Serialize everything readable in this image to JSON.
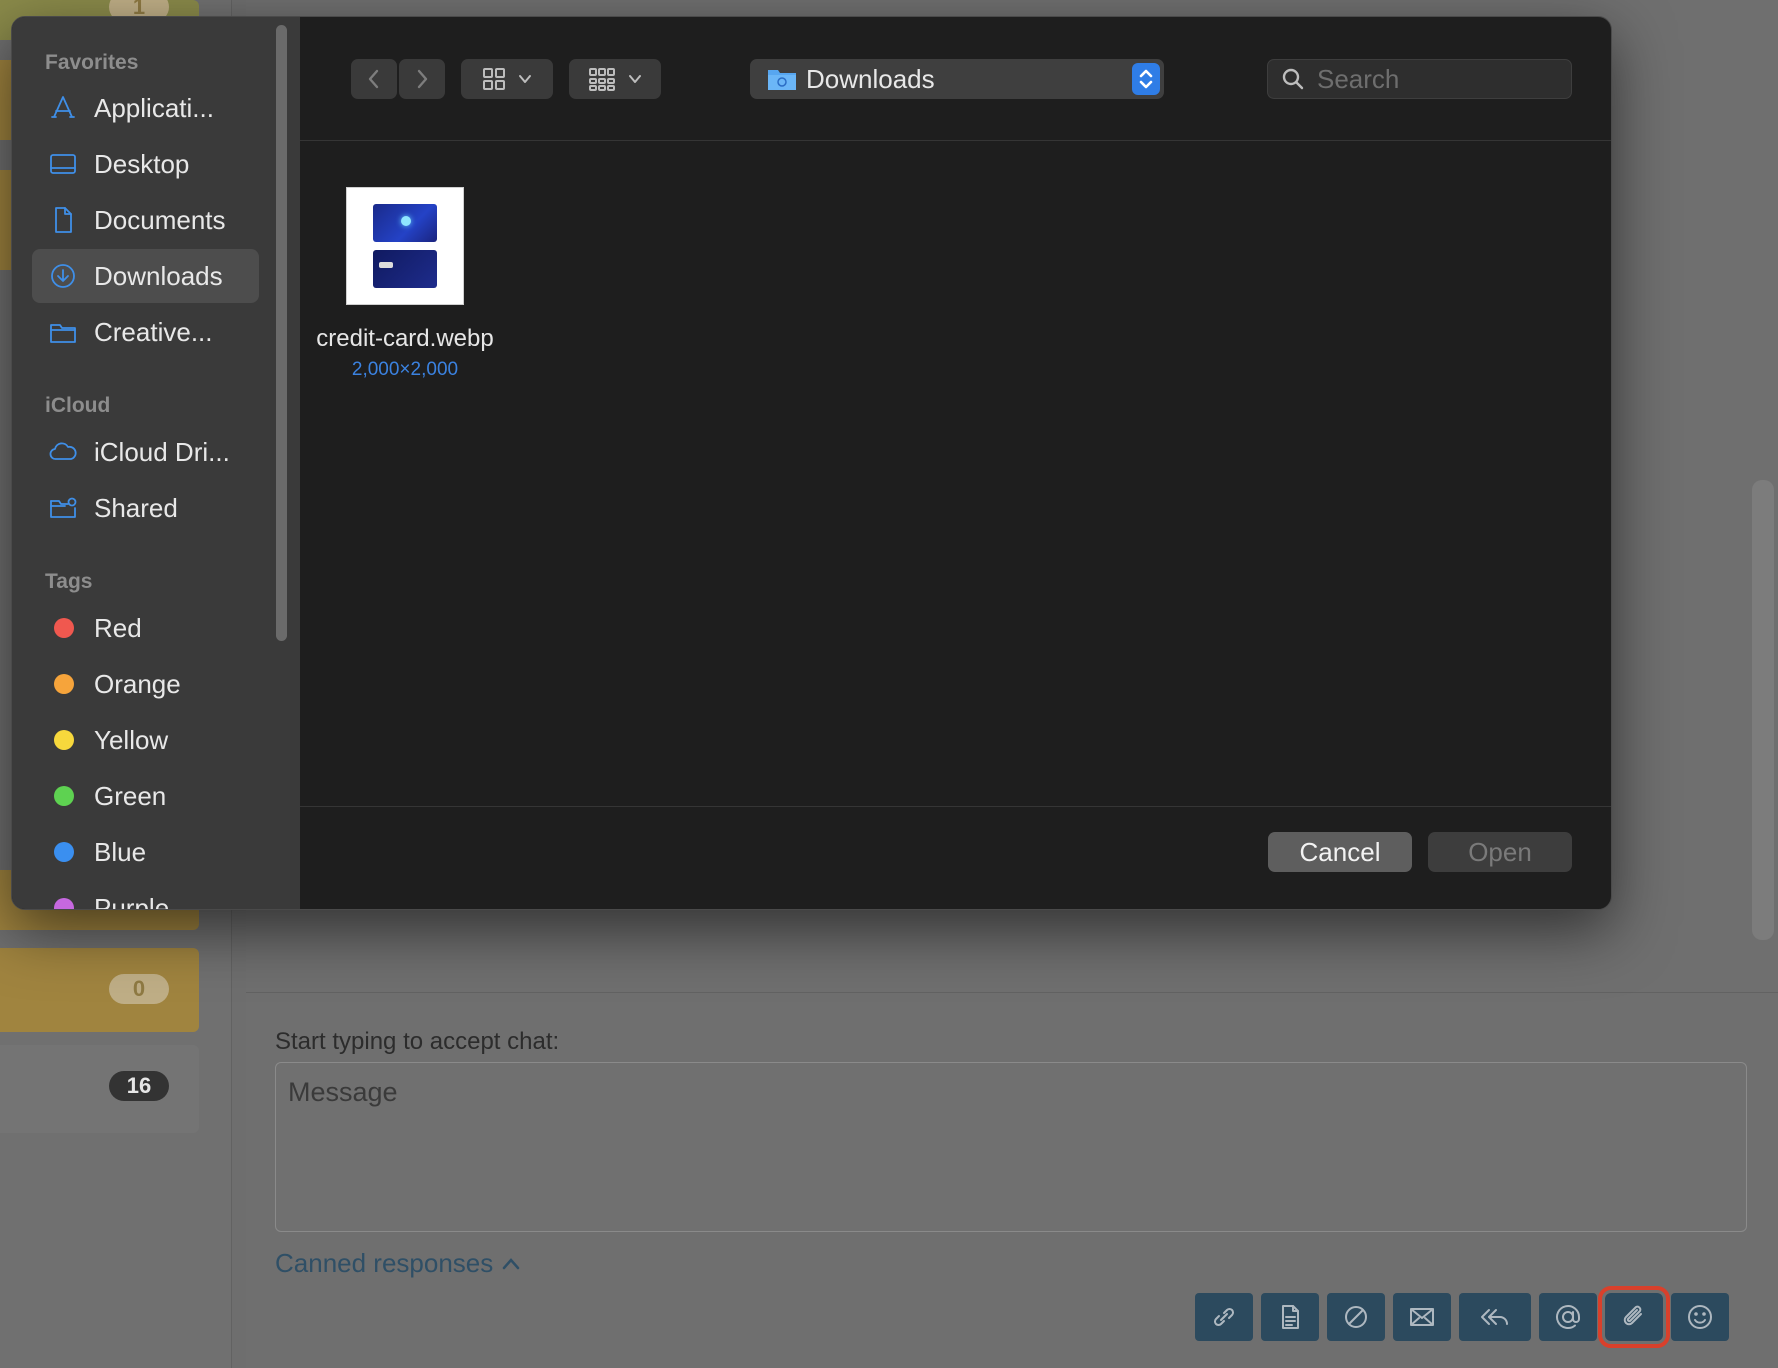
{
  "background": {
    "badges": [
      "1",
      "0",
      "16"
    ],
    "accept_label": "Start typing to accept chat:",
    "message_placeholder": "Message",
    "canned_label": "Canned responses",
    "toolbar_icons": [
      "link-icon",
      "document-icon",
      "cancel-icon",
      "mail-icon",
      "reply-all-icon",
      "at-sign-icon",
      "paperclip-icon",
      "smiley-icon"
    ],
    "highlight_color": "#d9402b"
  },
  "dialog": {
    "sidebar": {
      "favorites_header": "Favorites",
      "favorites": [
        {
          "label": "Applicati...",
          "icon": "applications-icon"
        },
        {
          "label": "Desktop",
          "icon": "desktop-icon"
        },
        {
          "label": "Documents",
          "icon": "document-icon"
        },
        {
          "label": "Downloads",
          "icon": "downloads-icon",
          "selected": true
        },
        {
          "label": "Creative...",
          "icon": "folder-icon"
        }
      ],
      "icloud_header": "iCloud",
      "icloud": [
        {
          "label": "iCloud Dri...",
          "icon": "cloud-icon"
        },
        {
          "label": "Shared",
          "icon": "shared-folder-icon"
        }
      ],
      "tags_header": "Tags",
      "tags": [
        {
          "label": "Red",
          "color": "#f0584f"
        },
        {
          "label": "Orange",
          "color": "#f6a43b"
        },
        {
          "label": "Yellow",
          "color": "#f7d83c"
        },
        {
          "label": "Green",
          "color": "#5ed251"
        },
        {
          "label": "Blue",
          "color": "#3a8ff0"
        },
        {
          "label": "Purple",
          "color": "#c668e0"
        }
      ]
    },
    "location": "Downloads",
    "search_placeholder": "Search",
    "file": {
      "name": "credit-card.webp",
      "dimensions": "2,000×2,000"
    },
    "cancel_label": "Cancel",
    "open_label": "Open",
    "accent_color": "#2f7de6"
  }
}
